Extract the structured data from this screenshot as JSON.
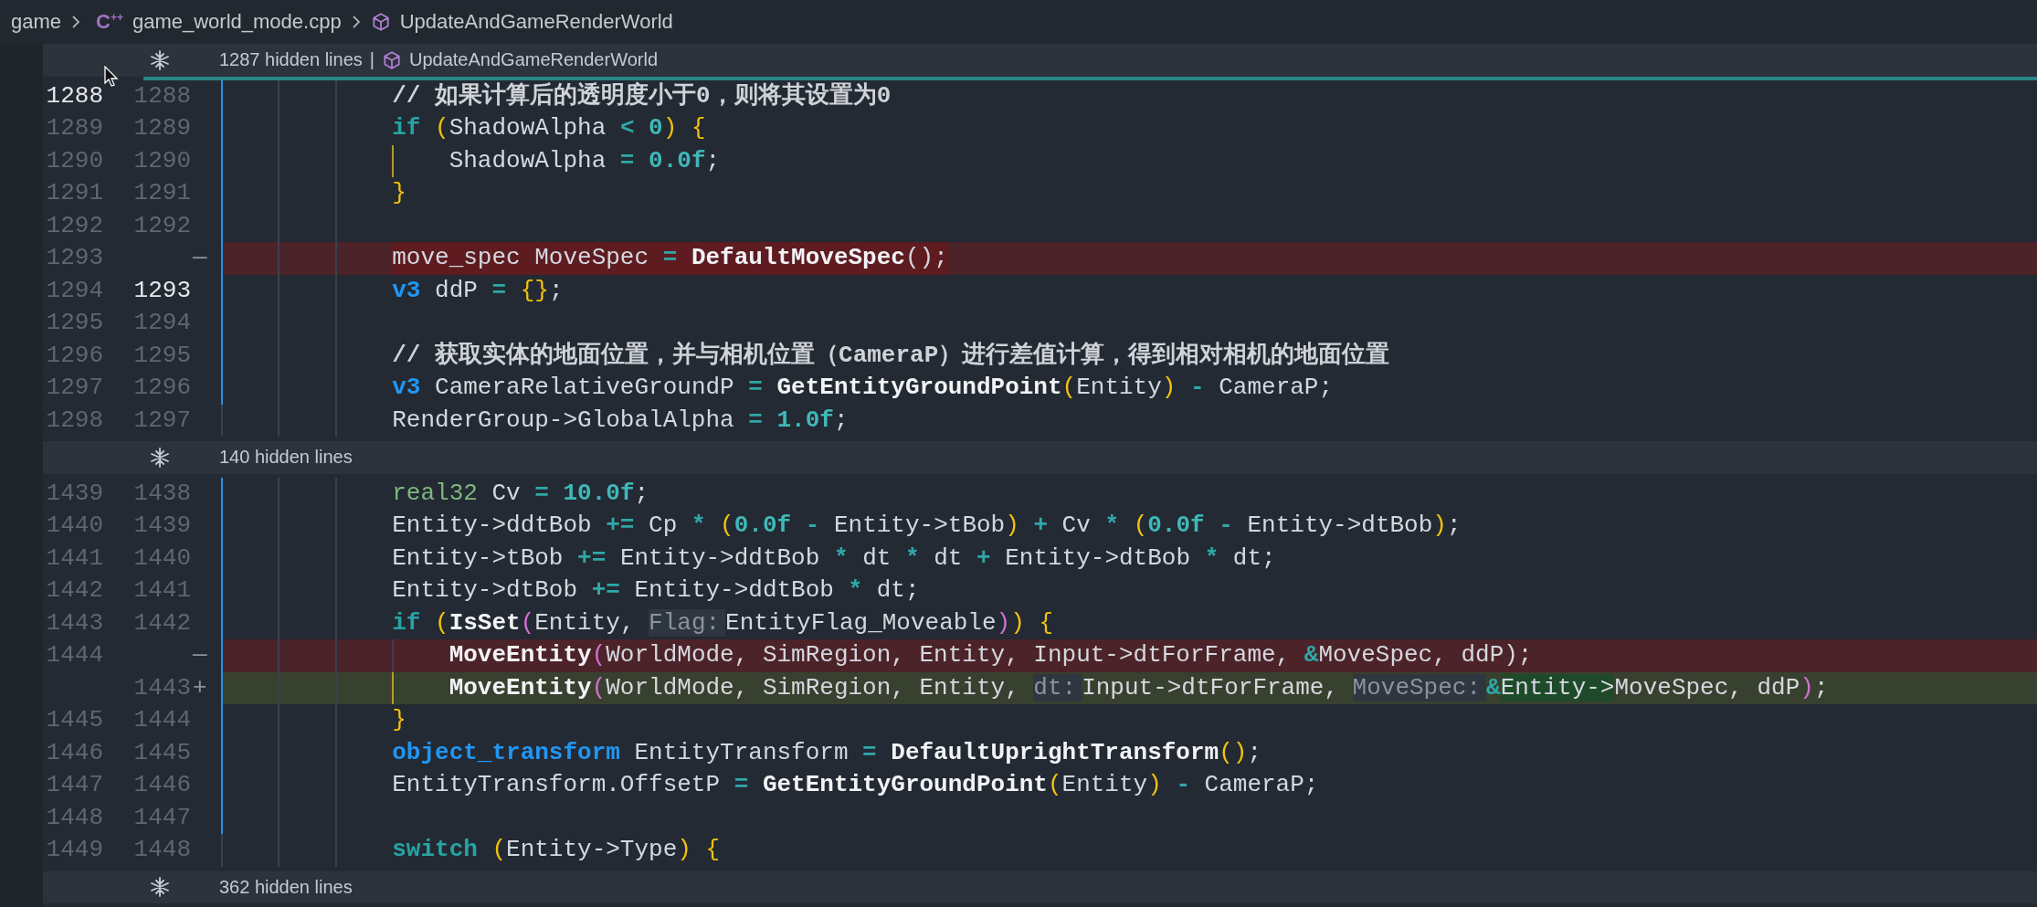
{
  "breadcrumb": [
    {
      "kind": "folder",
      "label": "game"
    },
    {
      "kind": "file",
      "icon_text": "C$^{++}$",
      "label": "game_world_mode.cpp"
    },
    {
      "kind": "symbol",
      "label": "UpdateAndGameRenderWorld"
    }
  ],
  "blocks": [
    {
      "kind": "fold",
      "text": "1287 hidden lines",
      "separator": "|",
      "symbol": "UpdateAndGameRenderWorld",
      "focused": true
    },
    {
      "kind": "line",
      "old": {
        "text": "1288",
        "current": true
      },
      "new": {
        "text": "1288",
        "current": false
      },
      "active_guide": true,
      "tokens": [
        {
          "kind": "comment",
          "text": "// 如果计算后的透明度小于0，则将其设置为0"
        }
      ]
    },
    {
      "kind": "line",
      "old": {
        "text": "1289",
        "current": false
      },
      "new": {
        "text": "1289",
        "current": false
      },
      "active_guide": true,
      "tokens": [
        {
          "kind": "keyword",
          "text": "if "
        },
        {
          "kind": "bracket1",
          "text": "("
        },
        {
          "kind": "plain",
          "text": "ShadowAlpha"
        },
        {
          "kind": "op",
          "text": " < "
        },
        {
          "kind": "num",
          "text": "0"
        },
        {
          "kind": "bracket1",
          "text": ") {"
        }
      ],
      "children": [
        {
          "kind": "line",
          "old": {
            "text": "1290",
            "current": false
          },
          "new": {
            "text": "1290",
            "current": false
          },
          "active_guide": true,
          "tokens": [
            {
              "kind": "plain",
              "text": "ShadowAlpha"
            },
            {
              "kind": "op",
              "text": " = "
            },
            {
              "kind": "num",
              "text": "0.0f"
            },
            {
              "kind": "plain",
              "text": ";"
            }
          ]
        }
      ]
    },
    {
      "kind": "line",
      "old": {
        "text": "1291",
        "current": false
      },
      "new": {
        "text": "1291",
        "current": false
      },
      "active_guide": true,
      "tokens": [
        {
          "kind": "bracket1",
          "text": "}"
        }
      ]
    },
    {
      "kind": "line",
      "old": {
        "text": "1292",
        "current": false
      },
      "new": {
        "text": "1292",
        "current": false
      },
      "active_guide": true
    },
    {
      "kind": "deleted",
      "old": {
        "text": "1293",
        "current": false
      },
      "marker": "—",
      "active_guide": true,
      "tokens": [
        {
          "kind": "plain",
          "text": "move_spec MoveSpec"
        },
        {
          "kind": "op",
          "text": " = "
        },
        {
          "kind": "func",
          "text": "DefaultMoveSpec"
        },
        {
          "kind": "plain",
          "text": "();"
        }
      ]
    },
    {
      "kind": "line",
      "old": {
        "text": "1294",
        "current": false
      },
      "new": {
        "text": "1293",
        "current": true
      },
      "active_guide": true,
      "tokens": [
        {
          "kind": "type",
          "text": "v3"
        },
        {
          "kind": "plain",
          "text": " ddP"
        },
        {
          "kind": "op",
          "text": " = "
        },
        {
          "kind": "bracket1",
          "text": "{}"
        },
        {
          "kind": "plain",
          "text": ";"
        }
      ]
    },
    {
      "kind": "line",
      "old": {
        "text": "1295",
        "current": false
      },
      "new": {
        "text": "1294",
        "current": false
      },
      "active_guide": true
    },
    {
      "kind": "line",
      "old": {
        "text": "1296",
        "current": false
      },
      "new": {
        "text": "1295",
        "current": false
      },
      "active_guide": true,
      "tokens": [
        {
          "kind": "comment",
          "text": "// 获取实体的地面位置，并与相机位置（CameraP）进行差值计算，得到相对相机的地面位置"
        }
      ]
    },
    {
      "kind": "line",
      "old": {
        "text": "1297",
        "current": false
      },
      "new": {
        "text": "1296",
        "current": false
      },
      "active_guide": true,
      "tokens": [
        {
          "kind": "type",
          "text": "v3"
        },
        {
          "kind": "plain",
          "text": " CameraRelativeGroundP"
        },
        {
          "kind": "op",
          "text": " = "
        },
        {
          "kind": "func",
          "text": "GetEntityGroundPoint"
        },
        {
          "kind": "bracket1",
          "text": "("
        },
        {
          "kind": "plain",
          "text": "Entity"
        },
        {
          "kind": "bracket1",
          "text": ")"
        },
        {
          "kind": "op",
          "text": " - "
        },
        {
          "kind": "plain",
          "text": "CameraP;"
        }
      ]
    },
    {
      "kind": "line",
      "old": {
        "text": "1298",
        "current": false
      },
      "new": {
        "text": "1297",
        "current": false
      },
      "active_guide": false,
      "tokens": [
        {
          "kind": "plain",
          "text": "RenderGroup->GlobalAlpha"
        },
        {
          "kind": "op",
          "text": " = "
        },
        {
          "kind": "num",
          "text": "1.0f"
        },
        {
          "kind": "plain",
          "text": ";"
        }
      ]
    },
    {
      "kind": "fold",
      "text": "140 hidden lines",
      "focused": false
    },
    {
      "kind": "line",
      "old": {
        "text": "1439",
        "current": false
      },
      "new": {
        "text": "1438",
        "current": false
      },
      "active_guide": true,
      "tokens": [
        {
          "kind": "builtin",
          "text": "real32"
        },
        {
          "kind": "plain",
          "text": " Cv"
        },
        {
          "kind": "op",
          "text": " = "
        },
        {
          "kind": "num",
          "text": "10.0f"
        },
        {
          "kind": "plain",
          "text": ";"
        }
      ]
    },
    {
      "kind": "line",
      "old": {
        "text": "1440",
        "current": false
      },
      "new": {
        "text": "1439",
        "current": false
      },
      "active_guide": true,
      "tokens": [
        {
          "kind": "plain",
          "text": "Entity->ddtBob"
        },
        {
          "kind": "op",
          "text": " += "
        },
        {
          "kind": "plain",
          "text": "Cp"
        },
        {
          "kind": "op",
          "text": " * "
        },
        {
          "kind": "bracket1",
          "text": "("
        },
        {
          "kind": "num",
          "text": "0.0f"
        },
        {
          "kind": "op",
          "text": " - "
        },
        {
          "kind": "plain",
          "text": "Entity->tBob"
        },
        {
          "kind": "bracket1",
          "text": ")"
        },
        {
          "kind": "op",
          "text": " + "
        },
        {
          "kind": "plain",
          "text": "Cv"
        },
        {
          "kind": "op",
          "text": " * "
        },
        {
          "kind": "bracket1",
          "text": "("
        },
        {
          "kind": "num",
          "text": "0.0f"
        },
        {
          "kind": "op",
          "text": " - "
        },
        {
          "kind": "plain",
          "text": "Entity->dtBob"
        },
        {
          "kind": "bracket1",
          "text": ")"
        },
        {
          "kind": "plain",
          "text": ";"
        }
      ]
    },
    {
      "kind": "line",
      "old": {
        "text": "1441",
        "current": false
      },
      "new": {
        "text": "1440",
        "current": false
      },
      "active_guide": true,
      "tokens": [
        {
          "kind": "plain",
          "text": "Entity->tBob"
        },
        {
          "kind": "op",
          "text": " += "
        },
        {
          "kind": "plain",
          "text": "Entity->ddtBob"
        },
        {
          "kind": "op",
          "text": " * "
        },
        {
          "kind": "plain",
          "text": "dt"
        },
        {
          "kind": "op",
          "text": " * "
        },
        {
          "kind": "plain",
          "text": "dt"
        },
        {
          "kind": "op",
          "text": " + "
        },
        {
          "kind": "plain",
          "text": "Entity->dtBob"
        },
        {
          "kind": "op",
          "text": " * "
        },
        {
          "kind": "plain",
          "text": "dt;"
        }
      ]
    },
    {
      "kind": "line",
      "old": {
        "text": "1442",
        "current": false
      },
      "new": {
        "text": "1441",
        "current": false
      },
      "active_guide": true,
      "tokens": [
        {
          "kind": "plain",
          "text": "Entity->dtBob"
        },
        {
          "kind": "op",
          "text": " += "
        },
        {
          "kind": "plain",
          "text": "Entity->ddtBob"
        },
        {
          "kind": "op",
          "text": " * "
        },
        {
          "kind": "plain",
          "text": "dt;"
        }
      ]
    },
    {
      "kind": "line",
      "old": {
        "text": "1443",
        "current": false
      },
      "new": {
        "text": "1442",
        "current": false
      },
      "active_guide": true,
      "tokens": [
        {
          "kind": "keyword",
          "text": "if "
        },
        {
          "kind": "bracket1",
          "text": "("
        },
        {
          "kind": "func",
          "text": "IsSet"
        },
        {
          "kind": "bracket2",
          "text": "("
        },
        {
          "kind": "plain",
          "text": "Entity, "
        },
        {
          "kind": "hint",
          "text": "Flag:"
        },
        {
          "kind": "plain",
          "text": "EntityFlag_Moveable"
        },
        {
          "kind": "bracket2",
          "text": ")"
        },
        {
          "kind": "bracket1",
          "text": ") {"
        }
      ],
      "children": [
        {
          "kind": "modified_old",
          "old": {
            "text": "1444",
            "current": false
          },
          "marker": "—",
          "active_guide": true,
          "tokens": [
            {
              "kind": "func",
              "text": "MoveEntity"
            },
            {
              "kind": "bracket2",
              "text": "("
            },
            {
              "kind": "plain",
              "text": "WorldMode, SimRegion, Entity, Input->dtForFrame, "
            },
            {
              "kind": "amp",
              "text": "&"
            },
            {
              "kind": "plain",
              "text": "MoveSpec, ddP);"
            }
          ]
        },
        {
          "kind": "modified_new",
          "new": {
            "text": "1443",
            "current": false
          },
          "marker": "+",
          "active_guide": true,
          "tokens": [
            {
              "kind": "func",
              "text": "MoveEntity"
            },
            {
              "kind": "bracket2",
              "text": "("
            },
            {
              "kind": "plain",
              "text": "WorldMode, SimRegion, Entity, "
            },
            {
              "kind": "hint",
              "text": "dt:"
            },
            {
              "kind": "plain",
              "text": "Input->dtForFrame, "
            },
            {
              "kind": "hint",
              "text": "MoveSpec:"
            },
            {
              "kind": "amp",
              "text": "&"
            },
            {
              "kind": "inserted",
              "text": "Entity->"
            },
            {
              "kind": "plain",
              "text": "MoveSpec, ddP"
            },
            {
              "kind": "bracket2",
              "text": ")"
            },
            {
              "kind": "plain",
              "text": ";"
            }
          ]
        }
      ]
    },
    {
      "kind": "line",
      "old": {
        "text": "1445",
        "current": false
      },
      "new": {
        "text": "1444",
        "current": false
      },
      "active_guide": true,
      "tokens": [
        {
          "kind": "bracket1",
          "text": "}"
        }
      ]
    },
    {
      "kind": "line",
      "old": {
        "text": "1446",
        "current": false
      },
      "new": {
        "text": "1445",
        "current": false
      },
      "active_guide": true,
      "tokens": [
        {
          "kind": "type",
          "text": "object_transform"
        },
        {
          "kind": "plain",
          "text": " EntityTransform"
        },
        {
          "kind": "op",
          "text": " = "
        },
        {
          "kind": "func",
          "text": "DefaultUprightTransform"
        },
        {
          "kind": "bracket1",
          "text": "()"
        },
        {
          "kind": "plain",
          "text": ";"
        }
      ]
    },
    {
      "kind": "line",
      "old": {
        "text": "1447",
        "current": false
      },
      "new": {
        "text": "1446",
        "current": false
      },
      "active_guide": true,
      "tokens": [
        {
          "kind": "plain",
          "text": "EntityTransform.OffsetP"
        },
        {
          "kind": "op",
          "text": " = "
        },
        {
          "kind": "func",
          "text": "GetEntityGroundPoint"
        },
        {
          "kind": "bracket1",
          "text": "("
        },
        {
          "kind": "plain",
          "text": "Entity"
        },
        {
          "kind": "bracket1",
          "text": ")"
        },
        {
          "kind": "op",
          "text": " - "
        },
        {
          "kind": "plain",
          "text": "CameraP;"
        }
      ]
    },
    {
      "kind": "line",
      "old": {
        "text": "1448",
        "current": false
      },
      "new": {
        "text": "1447",
        "current": false
      },
      "active_guide": true
    },
    {
      "kind": "line",
      "old": {
        "text": "1449",
        "current": false
      },
      "new": {
        "text": "1448",
        "current": false
      },
      "active_guide": false,
      "tokens": [
        {
          "kind": "keyword",
          "text": "switch "
        },
        {
          "kind": "bracket1",
          "text": "("
        },
        {
          "kind": "plain",
          "text": "Entity->Type"
        },
        {
          "kind": "bracket1",
          "text": ") {"
        }
      ]
    },
    {
      "kind": "fold",
      "text": "362 hidden lines",
      "focused": false
    }
  ]
}
